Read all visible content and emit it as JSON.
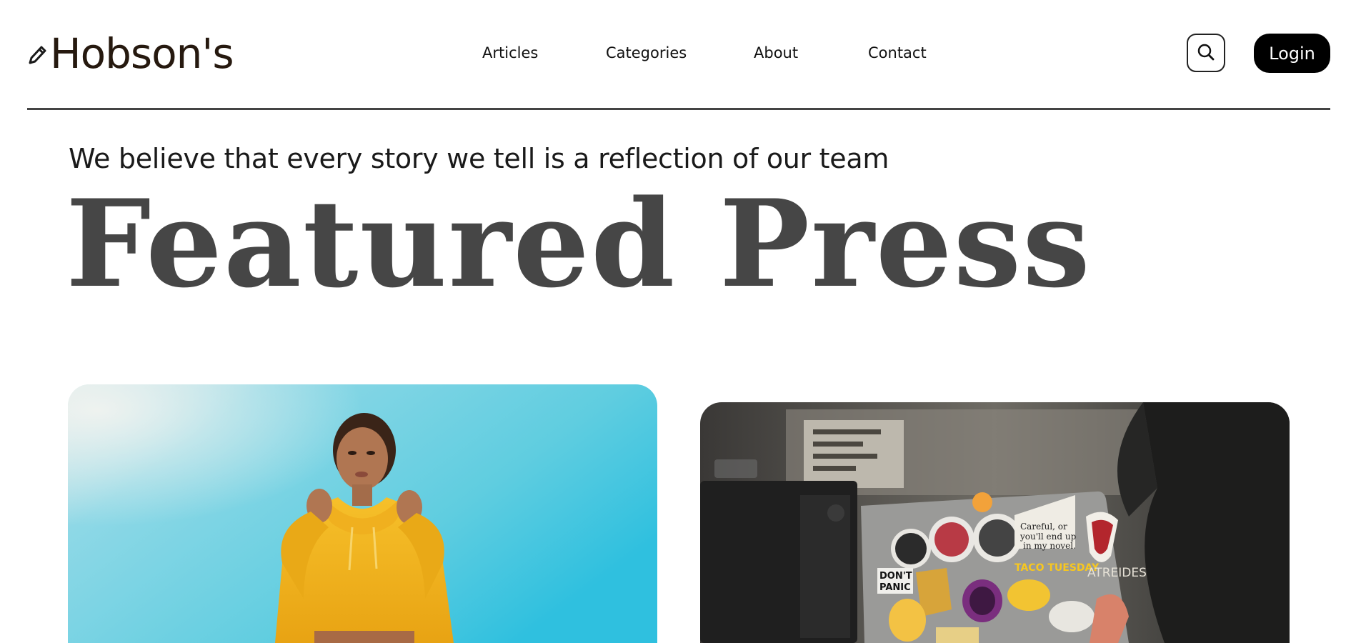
{
  "header": {
    "logo_text": "Hobson's",
    "logo_icon": "pencil-icon",
    "nav": [
      {
        "label": "Articles"
      },
      {
        "label": "Categories"
      },
      {
        "label": "About"
      },
      {
        "label": "Contact"
      }
    ],
    "search_icon": "search-icon",
    "login_label": "Login"
  },
  "hero": {
    "tagline": "We believe that every story we tell is a reflection of our team",
    "title": "Featured Press"
  },
  "cards": [
    {
      "image": "woman-in-yellow-hoodie-photo"
    },
    {
      "image": "laptop-with-stickers-photo",
      "sticker_texts": [
        "Careful, or you'll end up in my novel.",
        "DON'T PANIC",
        "TACO TUESDAY",
        "ATREIDES"
      ]
    }
  ],
  "colors": {
    "background": "#ffffff",
    "logo": "#26190f",
    "title": "#464646",
    "login_bg": "#000000",
    "sky": "#5fcde0",
    "hoodie": "#f2b01e"
  }
}
